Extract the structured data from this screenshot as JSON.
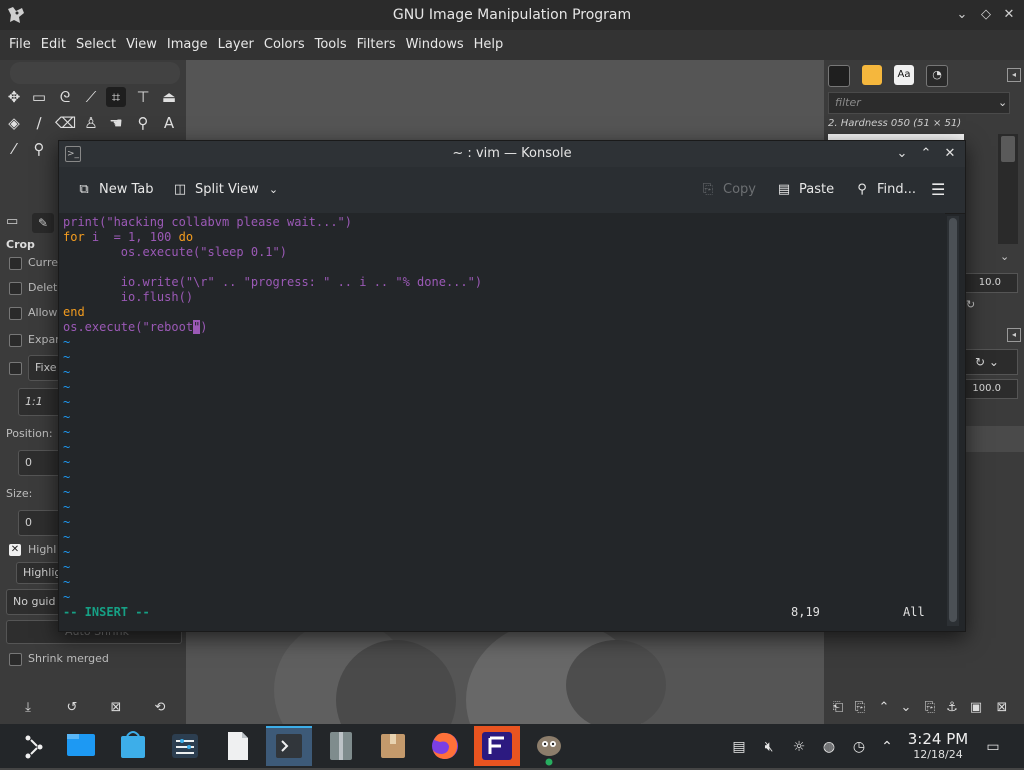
{
  "gimp": {
    "window_title": "GNU Image Manipulation Program",
    "menu": [
      "File",
      "Edit",
      "Select",
      "View",
      "Image",
      "Layer",
      "Colors",
      "Tools",
      "Filters",
      "Windows",
      "Help"
    ],
    "tool_options": {
      "title": "Crop",
      "current_layer_only": "Curre",
      "delete_cropped": "Delet",
      "allow_growing": "Allow",
      "expand_from_center": "Expar",
      "fixed": "Fixe",
      "ratio": "1:1",
      "position_label": "Position:",
      "position_value": "0",
      "size_label": "Size:",
      "size_value": "0",
      "highlight_label": "Highl",
      "highlight_dropdown": "Highlig",
      "guides_dropdown": "No guid",
      "auto_shrink": "Auto Shrink",
      "shrink_merged": "Shrink merged"
    },
    "brushes": {
      "filter_placeholder": "filter",
      "selected_brush": "2. Hardness 050 (51 × 51)",
      "spacing_value": "10.0",
      "opacity_value": "100.0"
    }
  },
  "konsole": {
    "title": "~ : vim — Konsole",
    "toolbar": {
      "new_tab": "New Tab",
      "split_view": "Split View",
      "copy": "Copy",
      "paste": "Paste",
      "find": "Find..."
    },
    "code": {
      "l1_fn": "print(",
      "l1_str": "\"hacking collabvm please wait...\"",
      "l1_end": ")",
      "l2_for": "for",
      "l2_var": " i  = ",
      "l2_n1": "1",
      "l2_comma": ", ",
      "l2_n2": "100",
      "l2_do": " do",
      "l3_fn": "        os.execute(",
      "l3_str": "\"sleep 0.1\"",
      "l3_end": ")",
      "l5_fn": "        io.write(",
      "l5_s1": "\"\\r\"",
      "l5_op1": " .. ",
      "l5_s2": "\"progress: \"",
      "l5_op2": " .. i .. ",
      "l5_s3": "\"% done...\"",
      "l5_end": ")",
      "l6": "        io.flush()",
      "l7": "end",
      "l8_fn": "os.execute(",
      "l8_str": "\"reboot",
      "l8_cursor": "\"",
      "l8_end": ")"
    },
    "tilde": "~",
    "status": {
      "mode": "-- INSERT --",
      "position": "8,19",
      "scroll": "All"
    }
  },
  "taskbar": {
    "time": "3:24 PM",
    "date": "12/18/24"
  }
}
